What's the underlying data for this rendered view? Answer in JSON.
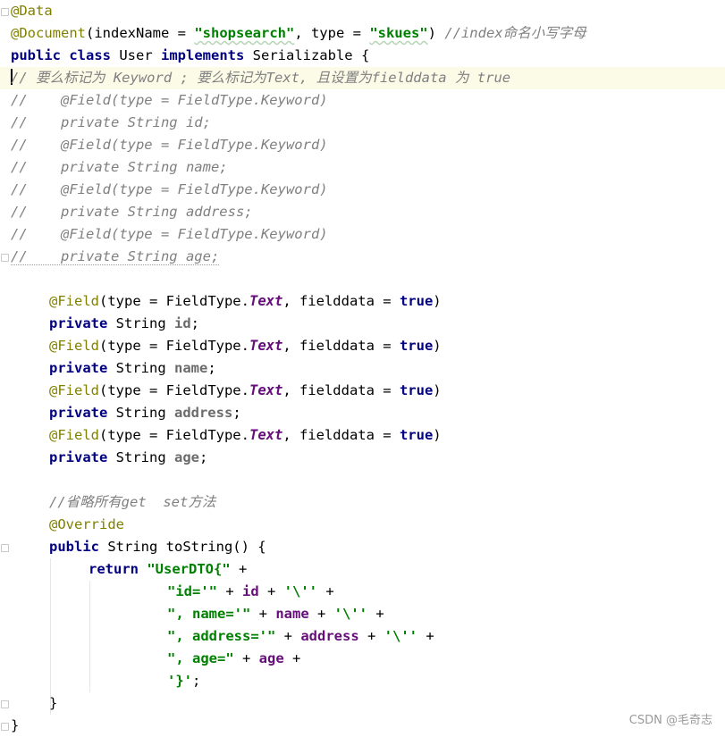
{
  "editor": {
    "lines": {
      "l01": {
        "a": "@Data"
      },
      "l02": {
        "a": "@Document",
        "b": "(indexName = ",
        "c": "\"shopsearch\"",
        "d": ", type = ",
        "e": "\"skues\"",
        "f": ") ",
        "g": "//index命名小写字母"
      },
      "l03": {
        "a": "public class ",
        "b": "User ",
        "c": "implements ",
        "d": "Serializable {"
      },
      "l04": {
        "a": "// 要么标记为 Keyword ; 要么标记为Text, 且设置为fielddata 为 true"
      },
      "l05": {
        "a": "//    @Field(type = FieldType.Keyword)"
      },
      "l06": {
        "a": "//    private String id;"
      },
      "l07": {
        "a": "//    @Field(type = FieldType.Keyword)"
      },
      "l08": {
        "a": "//    private String name;"
      },
      "l09": {
        "a": "//    @Field(type = FieldType.Keyword)"
      },
      "l10": {
        "a": "//    private String address;"
      },
      "l11": {
        "a": "//    @Field(type = FieldType.Keyword)"
      },
      "l12": {
        "a": "//    private String age;"
      },
      "l14": {
        "a": "@Field",
        "b": "(type = FieldType.",
        "c": "Text",
        "d": ", fielddata = ",
        "e": "true",
        "f": ")"
      },
      "l15": {
        "a": "private ",
        "b": "String ",
        "c": "id",
        "d": ";"
      },
      "l16": {
        "a": "@Field",
        "b": "(type = FieldType.",
        "c": "Text",
        "d": ", fielddata = ",
        "e": "true",
        "f": ")"
      },
      "l17": {
        "a": "private ",
        "b": "String ",
        "c": "name",
        "d": ";"
      },
      "l18": {
        "a": "@Field",
        "b": "(type = FieldType.",
        "c": "Text",
        "d": ", fielddata = ",
        "e": "true",
        "f": ")"
      },
      "l19": {
        "a": "private ",
        "b": "String ",
        "c": "address",
        "d": ";"
      },
      "l20": {
        "a": "@Field",
        "b": "(type = FieldType.",
        "c": "Text",
        "d": ", fielddata = ",
        "e": "true",
        "f": ")"
      },
      "l21": {
        "a": "private ",
        "b": "String ",
        "c": "age",
        "d": ";"
      },
      "l23": {
        "a": "//省略所有get  set方法"
      },
      "l24": {
        "a": "@Override"
      },
      "l25": {
        "a": "public ",
        "b": "String toString() {"
      },
      "l26": {
        "a": "return ",
        "b": "\"UserDTO{\"",
        "c": " +"
      },
      "l27": {
        "a": "\"id='\"",
        "b": " + ",
        "c": "id",
        "d": " + ",
        "e": "'\\''",
        "f": " +"
      },
      "l28": {
        "a": "\", name='\"",
        "b": " + ",
        "c": "name",
        "d": " + ",
        "e": "'\\''",
        "f": " +"
      },
      "l29": {
        "a": "\", address='\"",
        "b": " + ",
        "c": "address",
        "d": " + ",
        "e": "'\\''",
        "f": " +"
      },
      "l30": {
        "a": "\", age=\"",
        "b": " + ",
        "c": "age",
        "d": " +"
      },
      "l31": {
        "a": "'}'",
        "b": ";"
      },
      "l32": {
        "a": "}"
      },
      "l33": {
        "a": "}"
      }
    }
  },
  "watermark": "CSDN @毛奇志"
}
